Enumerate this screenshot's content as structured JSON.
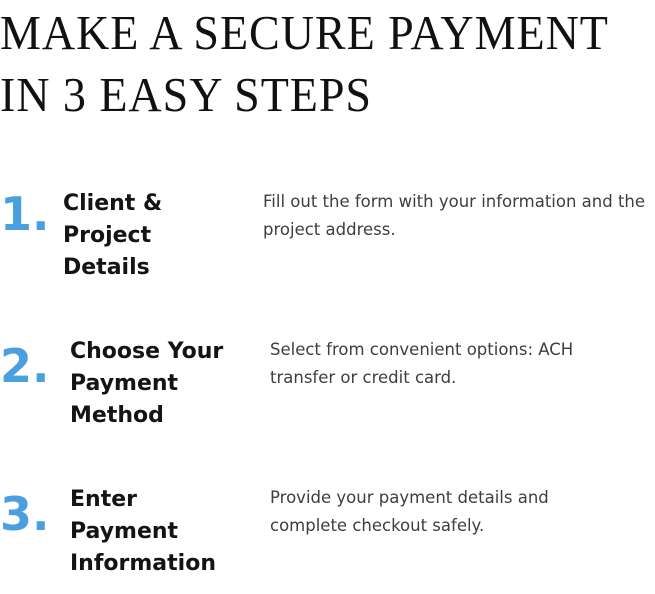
{
  "header": {
    "title_line_1": "MAKE A SECURE PAYMENT",
    "title_line_2": "IN 3 EASY STEPS"
  },
  "accent_color": "#4a9fde",
  "steps": [
    {
      "number": "1.",
      "title": "Client & Project Details",
      "description": "Fill out the form with your information and the project address."
    },
    {
      "number": "2.",
      "title": "Choose Your Payment Method",
      "description": "Select from convenient options: ACH transfer or credit card."
    },
    {
      "number": "3.",
      "title": "Enter Payment Information",
      "description": "Provide your payment details and complete checkout safely."
    }
  ]
}
